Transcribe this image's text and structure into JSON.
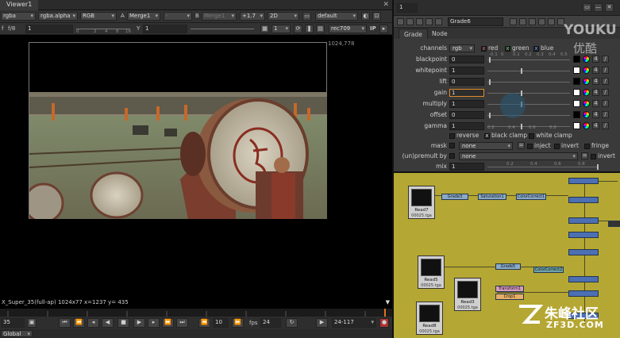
{
  "viewer": {
    "tab_label": "Viewer1",
    "toolbar1": {
      "channels": "rgba",
      "alpha": "rgba.alpha",
      "display": "RGB",
      "input_a_label": "A",
      "input_a": "Merge1",
      "mid_dropdown": "-",
      "input_b_label": "B",
      "input_b": "Merge1",
      "gain_value": "+1.7",
      "view_mode": "2D",
      "lut": "default"
    },
    "toolbar2": {
      "f_label": "f",
      "fstop": "f/8",
      "frame_value": "1",
      "ticks": [
        "0",
        "1",
        "2",
        "4",
        "8",
        "16"
      ],
      "y_label": "Y",
      "y_value": "1",
      "ticks_right": [
        "1",
        "4",
        "1"
      ],
      "proxy_value": "1",
      "colorspace": "rec709",
      "ip_label": "IP"
    },
    "resolution_label": "1024,778",
    "info_line": "X_Super_35(full-ap) 1024x77  x=1237 y= 435",
    "transport": {
      "current_frame": "35",
      "increment": "10",
      "fps_label": "fps",
      "fps_value": "24",
      "range": "24-117"
    },
    "bottom_dropdown": "Global"
  },
  "properties": {
    "top_field": "1",
    "node_name": "Grade6",
    "tabs": [
      {
        "label": "Grade"
      },
      {
        "label": "Node"
      }
    ],
    "channels_label": "channels",
    "channels_value": "rgb",
    "channel_checks": [
      {
        "label": "red"
      },
      {
        "label": "green"
      },
      {
        "label": "blue"
      }
    ],
    "rows": [
      {
        "label": "blackpoint",
        "value": "0",
        "knob": 0.0
      },
      {
        "label": "whitepoint",
        "value": "1",
        "knob": 0.4
      },
      {
        "label": "lift",
        "value": "0",
        "knob": 0.0
      },
      {
        "label": "gain",
        "value": "1",
        "knob": 0.4
      },
      {
        "label": "multiply",
        "value": "1",
        "knob": 0.4
      },
      {
        "label": "offset",
        "value": "0",
        "knob": 0.0
      },
      {
        "label": "gamma",
        "value": "1",
        "knob": 0.4
      }
    ],
    "slider_ticks_top": [
      "-0.1",
      "0",
      "0.1",
      "0.2",
      "0.3",
      "0.4",
      "0.5"
    ],
    "slider_ticks_bottom": [
      "0.2",
      "0.4",
      "0.6",
      "0.8"
    ],
    "row_count_badge": "4",
    "reverse_label": "reverse",
    "black_clamp_label": "black clamp",
    "white_clamp_label": "white clamp",
    "mask_label": "mask",
    "mask_value": "none",
    "inject_label": "inject",
    "invert_label": "invert",
    "fringe_label": "fringe",
    "premult_label": "(un)premult by",
    "premult_value": "none",
    "premult_invert_label": "invert",
    "mix_label": "mix",
    "mix_value": "1",
    "mix_ticks": [
      "0.2",
      "0.4",
      "0.6",
      "0.8"
    ]
  },
  "graph": {
    "read_nodes": [
      {
        "name": "Read7",
        "file": "00025.tga"
      },
      {
        "name": "Read5",
        "file": "00025.tga"
      },
      {
        "name": "Read3",
        "file": "00025.tga"
      },
      {
        "name": "Read8",
        "file": "00025.tga"
      }
    ],
    "nodes": [
      {
        "label": "Grade3"
      },
      {
        "label": "Saturation1"
      },
      {
        "label": "ColorCorrect1"
      },
      {
        "label": "Grade5"
      },
      {
        "label": "ColorCorrect2"
      },
      {
        "label": "Transform1"
      },
      {
        "label": "Crop1"
      }
    ]
  },
  "watermarks": {
    "top_latin": "YOUKU",
    "top_cn": "优酷",
    "bottom_cn": "朱峰社区",
    "bottom_url": "ZF3D.COM"
  }
}
